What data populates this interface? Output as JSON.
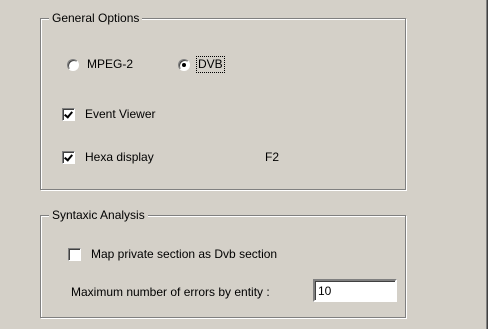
{
  "general_options": {
    "title": "General Options",
    "mode": {
      "options": [
        {
          "label": "MPEG-2",
          "selected": false
        },
        {
          "label": "DVB",
          "selected": true
        }
      ]
    },
    "event_viewer": {
      "label": "Event Viewer",
      "checked": true
    },
    "hexa_display": {
      "label": "Hexa display",
      "checked": true,
      "shortcut": "F2"
    }
  },
  "syntaxic_analysis": {
    "title": "Syntaxic Analysis",
    "map_private": {
      "label": "Map private section as Dvb section",
      "checked": false
    },
    "max_errors": {
      "label": "Maximum number of errors by entity :",
      "value": "10"
    }
  },
  "colors": {
    "dialog_face": "#d4d0c8",
    "shadow": "#808080",
    "highlight": "#ffffff",
    "field": "#ffffff"
  }
}
